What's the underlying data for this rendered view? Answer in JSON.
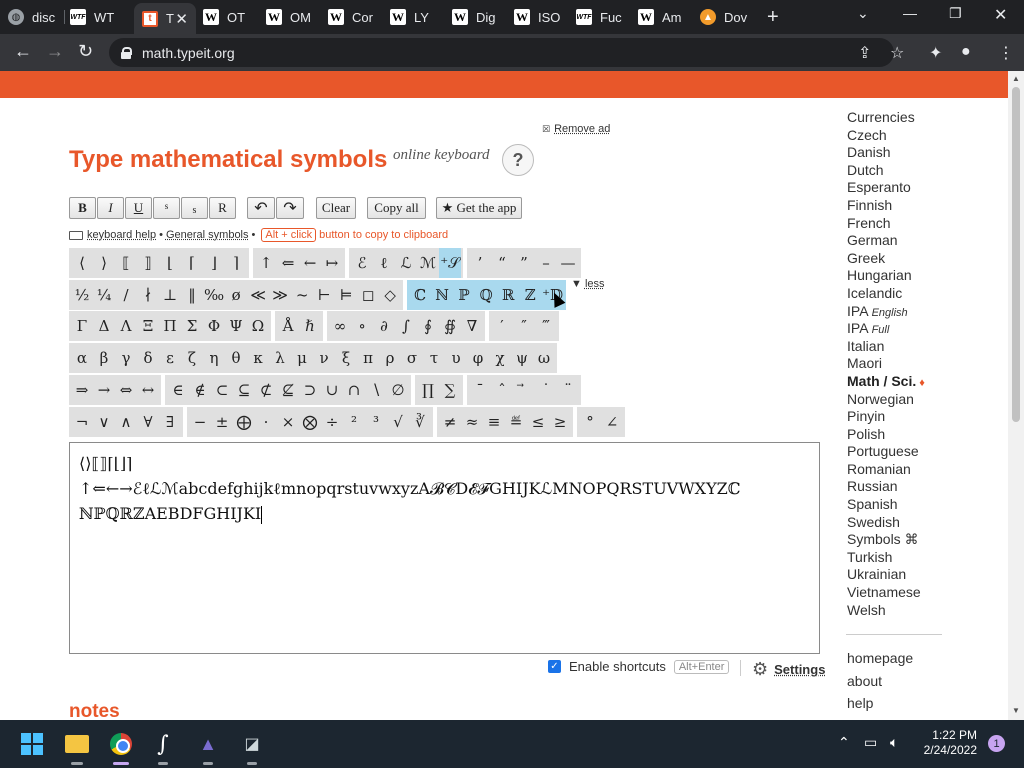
{
  "browser": {
    "tabs": [
      {
        "label": "disc",
        "icon": "globe-icon"
      },
      {
        "label": "WT",
        "icon": "wtf-icon"
      },
      {
        "label": "T",
        "icon": "typeit-icon",
        "active": true
      },
      {
        "label": "OT",
        "icon": "wikipedia-icon"
      },
      {
        "label": "OM",
        "icon": "wikipedia-icon"
      },
      {
        "label": "Cor",
        "icon": "wikipedia-icon"
      },
      {
        "label": "LY",
        "icon": "wikipedia-icon"
      },
      {
        "label": "Dig",
        "icon": "wikipedia-icon"
      },
      {
        "label": "ISO",
        "icon": "wikipedia-icon"
      },
      {
        "label": "Fuc",
        "icon": "wtf-icon"
      },
      {
        "label": "Am",
        "icon": "wikipedia-icon"
      },
      {
        "label": "Dov",
        "icon": "download-icon"
      }
    ],
    "url": "math.typeit.org"
  },
  "page": {
    "remove_ad": "Remove ad",
    "title": "Type mathematical symbols",
    "subtitle": "online keyboard",
    "help_label": "?",
    "toolbar": {
      "bold": "B",
      "italic": "I",
      "underline": "U",
      "superscript": "s",
      "subscript": "s",
      "reset": "R",
      "undo": "↶",
      "redo": "↷",
      "clear": "Clear",
      "copy_all": "Copy all",
      "get_app": "★ Get the app"
    },
    "hint": {
      "keyboard_help": "keyboard help",
      "bullet": "•",
      "general_symbols": "General symbols",
      "alt_click": "Alt + click",
      "copy_text": "button to copy to clipboard"
    },
    "less_label": "less",
    "keyboard": {
      "row1": [
        [
          "⟨",
          "⟩",
          "⟦",
          "⟧",
          "⌊",
          "⌈",
          "⌋",
          "⌉"
        ],
        [
          "↑",
          "⇐",
          "←",
          "↦"
        ],
        [
          "ℰ",
          "ℓ",
          "ℒ",
          "ℳ",
          "⁺𝒮"
        ],
        [
          "’",
          "“",
          "”",
          "–",
          "—"
        ]
      ],
      "row2": [
        [
          "½",
          "¼",
          "/",
          "∤",
          "⊥",
          "‖",
          "‰",
          "ø",
          "≪",
          "≫",
          "~",
          "⊢",
          "⊨",
          "◻",
          "◇"
        ],
        [
          "ℂ",
          "ℕ",
          "ℙ",
          "ℚ",
          "ℝ",
          "ℤ",
          "⁺𝔻"
        ]
      ],
      "row3": [
        [
          "Γ",
          "Δ",
          "Λ",
          "Ξ",
          "Π",
          "Σ",
          "Φ",
          "Ψ",
          "Ω"
        ],
        [
          "Å",
          "ℏ"
        ],
        [
          "∞",
          "∘",
          "∂",
          "∫",
          "∮",
          "∯",
          "∇"
        ],
        [
          "′",
          "″",
          "‴"
        ]
      ],
      "row4": [
        [
          "α",
          "β",
          "γ",
          "δ",
          "ε",
          "ζ",
          "η",
          "θ",
          "κ",
          "λ",
          "μ",
          "ν",
          "ξ",
          "π",
          "ρ",
          "σ",
          "τ",
          "υ",
          "φ",
          "χ",
          "ψ",
          "ω"
        ]
      ],
      "row5": [
        [
          "⇒",
          "→",
          "⇔",
          "↔"
        ],
        [
          "∈",
          "∉",
          "⊂",
          "⊆",
          "⊄",
          "⊈",
          "⊃",
          "∪",
          "∩",
          "∖",
          "∅"
        ],
        [
          "∏",
          "∑"
        ],
        [
          "¯",
          "ˆ",
          "⃗",
          "˙",
          "¨"
        ]
      ],
      "row6": [
        [
          "¬",
          "∨",
          "∧",
          "∀",
          "∃"
        ],
        [
          "−",
          "±",
          "⨁",
          "·",
          "×",
          "⨂",
          "÷",
          "²",
          "³",
          "√",
          "∛"
        ],
        [
          "≠",
          "≈",
          "≡",
          "≝",
          "≤",
          "≥"
        ],
        [
          "°",
          "∠"
        ]
      ]
    },
    "editor_text": "⟨⟩⟦⟧⌈⌊⌋⌉\n↑⇐←→ℰℓℒℳabcdefghijkℓmnopqrstuvwxyzA𝓑𝓒D𝓔𝓕GHIJKℒMNOPQRSTUVWXYZℂ\nℕℙℚℝℤAEBDFGHIJKI",
    "enable_shortcuts": "Enable shortcuts",
    "shortcut_key": "Alt+Enter",
    "settings": "Settings",
    "notes": "notes"
  },
  "sidebar": {
    "languages": [
      "Currencies",
      "Czech",
      "Danish",
      "Dutch",
      "Esperanto",
      "Finnish",
      "French",
      "German",
      "Greek",
      "Hungarian",
      "Icelandic",
      "IPA",
      "IPA",
      "Italian",
      "Maori",
      "Math / Sci.",
      "Norwegian",
      "Pinyin",
      "Polish",
      "Portuguese",
      "Romanian",
      "Russian",
      "Spanish",
      "Swedish",
      "Symbols ⌘",
      "Turkish",
      "Ukrainian",
      "Vietnamese",
      "Welsh"
    ],
    "ipa_english": "English",
    "ipa_full": "Full",
    "links": [
      "homepage",
      "about",
      "help"
    ]
  },
  "taskbar": {
    "time": "1:22 PM",
    "date": "2/24/2022",
    "notifications": "1"
  },
  "colors": {
    "brand": "#e8572a",
    "highlight": "#a9d9ee",
    "key_bg": "#e0e0e0"
  }
}
